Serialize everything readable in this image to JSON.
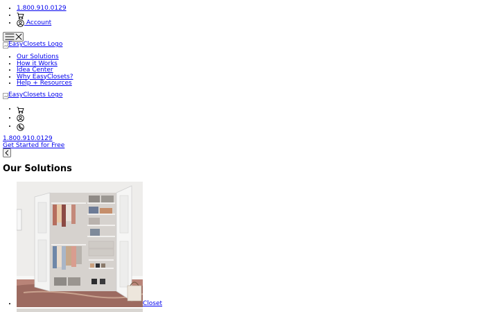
{
  "utility": {
    "phone": "1.800.910.0129",
    "account_label": "Account"
  },
  "header": {
    "logo_alt": "EasyClosets Logo"
  },
  "nav": {
    "items": [
      {
        "label": "Our Solutions"
      },
      {
        "label": "How it Works"
      },
      {
        "label": "Idea Center"
      },
      {
        "label": "Why EasyClosets?"
      },
      {
        "label": "Help + Resources"
      }
    ]
  },
  "secondary": {
    "logo_alt": "EasyClosets Logo",
    "phone": "1.800.910.0129",
    "cta": "Get Started for Free"
  },
  "panel": {
    "title": "Our Solutions",
    "items": [
      {
        "label": "Closet"
      }
    ]
  },
  "icons": {
    "cart": "cart-icon",
    "account": "user-circle-icon",
    "phone": "phone-icon",
    "menu": "hamburger-icon",
    "close": "close-icon",
    "back": "chevron-left-icon"
  },
  "colors": {
    "link": "#0000ee",
    "text": "#000000",
    "background": "#ffffff"
  }
}
